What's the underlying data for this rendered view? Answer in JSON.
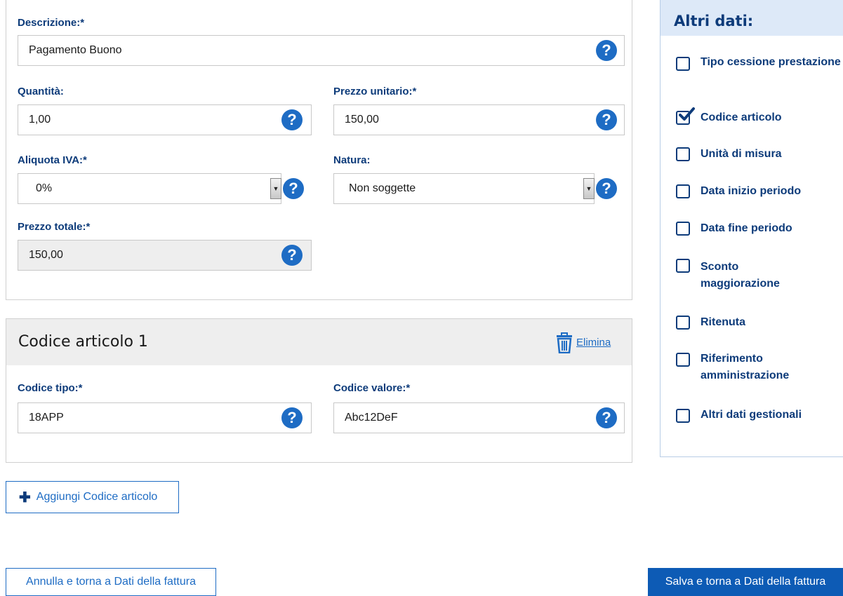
{
  "form": {
    "descrizione": {
      "label": "Descrizione:*",
      "value": "Pagamento Buono"
    },
    "quantita": {
      "label": "Quantità:",
      "value": "1,00"
    },
    "prezzo_unitario": {
      "label": "Prezzo unitario:*",
      "value": "150,00"
    },
    "aliquota_iva": {
      "label": "Aliquota IVA:*",
      "value": "0%"
    },
    "natura": {
      "label": "Natura:",
      "value": "Non soggette"
    },
    "prezzo_totale": {
      "label": "Prezzo totale:*",
      "value": "150,00"
    }
  },
  "codice_articolo": {
    "title": "Codice articolo 1",
    "delete_label": "Elimina",
    "codice_tipo": {
      "label": "Codice tipo:*",
      "value": "18APP"
    },
    "codice_valore": {
      "label": "Codice valore:*",
      "value": "Abc12DeF"
    }
  },
  "buttons": {
    "add_codice": "Aggiungi Codice articolo",
    "annulla": "Annulla e torna a Dati della fattura",
    "salva": "Salva e torna a Dati della fattura"
  },
  "help_glyph": "?",
  "side": {
    "title": "Altri dati:",
    "options": [
      {
        "label": "Tipo cessione prestazione",
        "checked": false
      },
      {
        "label": "Codice articolo",
        "checked": true
      },
      {
        "label": "Unità di misura",
        "checked": false
      },
      {
        "label": "Data inizio periodo",
        "checked": false
      },
      {
        "label": "Data fine periodo",
        "checked": false
      },
      {
        "label": "Sconto maggiorazione",
        "checked": false
      },
      {
        "label": "Ritenuta",
        "checked": false
      },
      {
        "label": "Riferimento amministrazione",
        "checked": false
      },
      {
        "label": "Altri dati gestionali",
        "checked": false
      }
    ]
  },
  "colors": {
    "accent": "#1e6cc4",
    "label": "#0d3b7a",
    "primary_button": "#0d5bb5"
  }
}
